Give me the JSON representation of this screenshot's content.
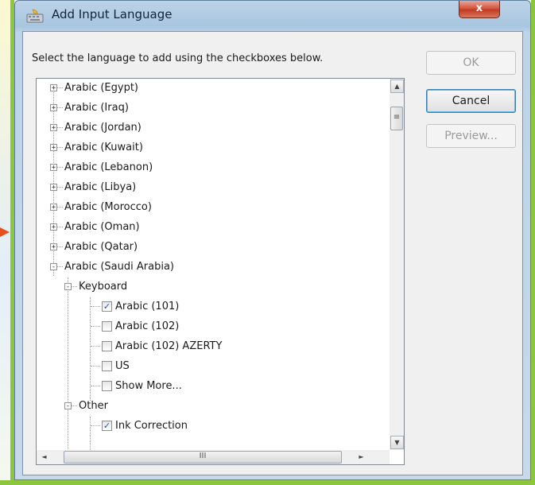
{
  "window": {
    "title": "Add Input Language",
    "close_symbol": "x"
  },
  "dialog": {
    "instruction": "Select the language to add using the checkboxes below."
  },
  "buttons": {
    "ok": "OK",
    "cancel": "Cancel",
    "preview": "Preview..."
  },
  "tree": {
    "languages": [
      "Arabic (Egypt)",
      "Arabic (Iraq)",
      "Arabic (Jordan)",
      "Arabic (Kuwait)",
      "Arabic (Lebanon)",
      "Arabic (Libya)",
      "Arabic (Morocco)",
      "Arabic (Oman)",
      "Arabic (Qatar)",
      "Arabic (Saudi Arabia)"
    ],
    "expanded_language": "Arabic (Saudi Arabia)",
    "keyboard_group": "Keyboard",
    "keyboards": [
      {
        "label": "Arabic (101)",
        "checked": true
      },
      {
        "label": "Arabic (102)",
        "checked": false
      },
      {
        "label": "Arabic (102) AZERTY",
        "checked": false
      },
      {
        "label": "US",
        "checked": false
      },
      {
        "label": "Show More...",
        "checked": false
      }
    ],
    "other_group": "Other",
    "other_items": [
      {
        "label": "Ink Correction",
        "checked": true
      }
    ],
    "expander_collapsed": "+",
    "expander_expanded": "-"
  },
  "scrollbars": {
    "up": "▲",
    "down": "▼",
    "left": "◄",
    "right": "►",
    "v_grip": "≡",
    "h_grip": "III"
  },
  "colors": {
    "accent_green": "#8cc63f",
    "pointer_orange": "#e8501e",
    "close_red": "#c23a22",
    "check_blue": "#21569c"
  },
  "icons": {
    "title": "keyboard-language-icon",
    "close": "close-icon",
    "pointer": "arrow-right-icon"
  }
}
